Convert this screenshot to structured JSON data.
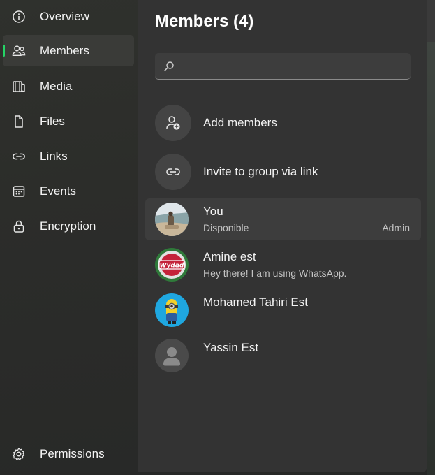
{
  "sidebar": {
    "items": [
      {
        "label": "Overview",
        "icon": "info-icon"
      },
      {
        "label": "Members",
        "icon": "people-icon",
        "active": true
      },
      {
        "label": "Media",
        "icon": "media-icon"
      },
      {
        "label": "Files",
        "icon": "file-icon"
      },
      {
        "label": "Links",
        "icon": "link-icon"
      },
      {
        "label": "Events",
        "icon": "calendar-icon"
      },
      {
        "label": "Encryption",
        "icon": "lock-icon"
      }
    ],
    "bottom": {
      "label": "Permissions",
      "icon": "gear-icon"
    }
  },
  "main": {
    "title": "Members (4)",
    "search": {
      "placeholder": "",
      "value": ""
    },
    "actions": [
      {
        "label": "Add members",
        "icon": "add-person-icon"
      },
      {
        "label": "Invite to group via link",
        "icon": "link-icon"
      }
    ],
    "members": [
      {
        "name": "You",
        "status": "Disponible",
        "role": "Admin"
      },
      {
        "name": "Amine est",
        "status": "Hey there! I am using WhatsApp.",
        "role": ""
      },
      {
        "name": "Mohamed Tahiri Est",
        "status": "",
        "role": ""
      },
      {
        "name": "Yassin Est",
        "status": "",
        "role": ""
      }
    ]
  },
  "colors": {
    "accent": "#25d366",
    "panel": "#333333",
    "sidebar": "#2c2d2a"
  }
}
